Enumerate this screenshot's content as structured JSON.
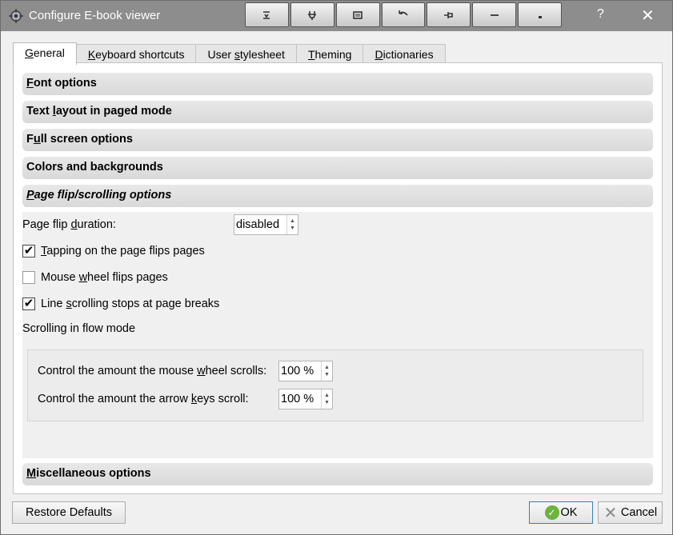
{
  "window": {
    "title": "Configure E-book viewer",
    "help_label": "?",
    "close_label": "✕",
    "toolbar_icons": [
      "download-icon",
      "plug-icon",
      "frame-icon",
      "undo-icon",
      "pin-icon",
      "minimize-icon",
      "restore-icon"
    ]
  },
  "tabs": [
    {
      "pre": "",
      "key": "G",
      "post": "eneral"
    },
    {
      "pre": "",
      "key": "K",
      "post": "eyboard shortcuts"
    },
    {
      "pre": "User ",
      "key": "s",
      "post": "tylesheet"
    },
    {
      "pre": "",
      "key": "T",
      "post": "heming"
    },
    {
      "pre": "",
      "key": "D",
      "post": "ictionaries"
    }
  ],
  "sections": {
    "font": {
      "key": "F",
      "post": "ont options"
    },
    "text_layout": {
      "pre": "Text ",
      "key": "l",
      "post": "ayout in paged mode"
    },
    "full_screen": {
      "pre": "F",
      "key": "u",
      "post": "ll screen options"
    },
    "colors": {
      "pre": "Colors and backgrounds"
    },
    "page_flip": {
      "key": "P",
      "post": "age flip/scrolling options"
    },
    "misc": {
      "key": "M",
      "post": "iscellaneous options"
    }
  },
  "page_flip": {
    "duration_label_pre": "Page flip ",
    "duration_label_key": "d",
    "duration_label_post": "uration:",
    "duration_value": "disabled",
    "tap_pre": "",
    "tap_key": "T",
    "tap_post": "apping on the page flips pages",
    "tap_checked": "✔",
    "wheel_pre": "Mouse ",
    "wheel_key": "w",
    "wheel_post": "heel flips pages",
    "line_pre": "Line ",
    "line_key": "s",
    "line_post": "crolling stops at page breaks",
    "line_checked": "✔",
    "scrolling_heading": "Scrolling in flow mode",
    "mouse_wheel_pre": "Control the amount the mouse ",
    "mouse_wheel_key": "w",
    "mouse_wheel_post": "heel scrolls:",
    "mouse_wheel_value": "100 %",
    "arrow_pre": "Control the amount the arrow ",
    "arrow_key": "k",
    "arrow_post": "eys scroll:",
    "arrow_value": "100 %"
  },
  "footer": {
    "restore_label": "Restore Defaults",
    "ok_label": "OK",
    "cancel_label": "Cancel"
  }
}
